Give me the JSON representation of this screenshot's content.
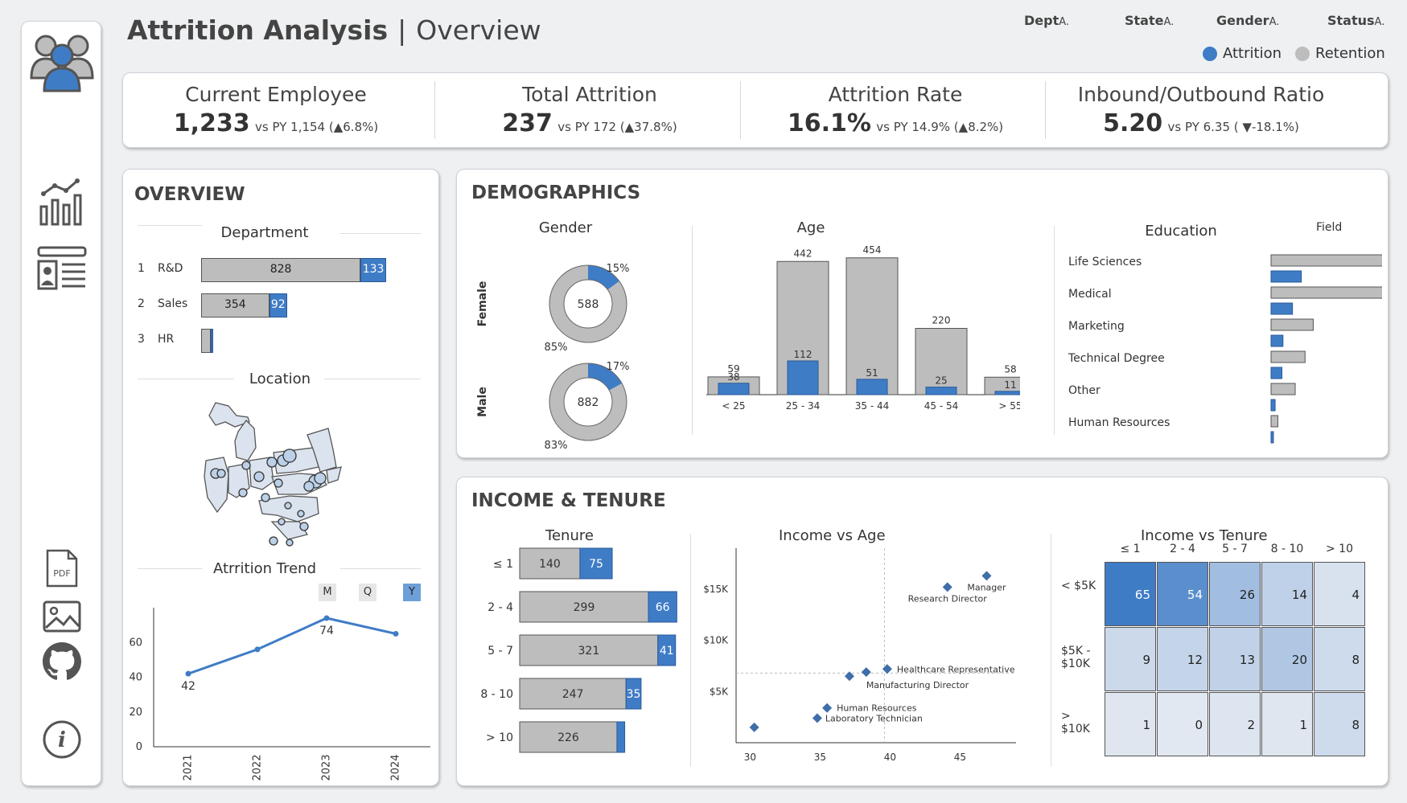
{
  "header": {
    "title": "Attrition Analysis",
    "separator": "|",
    "subtitle": "Overview",
    "filters": [
      {
        "label": "Dept",
        "suffix": "A."
      },
      {
        "label": "State",
        "suffix": "A."
      },
      {
        "label": "Gender",
        "suffix": "A."
      },
      {
        "label": "Status",
        "suffix": "A."
      }
    ],
    "legend": [
      {
        "label": "Attrition",
        "color": "#3f7cc6"
      },
      {
        "label": "Retention",
        "color": "#bdbdbd"
      }
    ]
  },
  "sidebar": {
    "icons": [
      "users-icon",
      "bar-chart-icon",
      "profile-card-icon",
      "pdf-icon",
      "image-icon",
      "github-icon",
      "info-icon"
    ],
    "pdf_label": "PDF",
    "info_label": "i"
  },
  "kpis": [
    {
      "label": "Current Employee",
      "value": "1,233",
      "vs": "vs PY 1,154 (▲6.8%)"
    },
    {
      "label": "Total Attrition",
      "value": "237",
      "vs": "vs PY 172 (▲37.8%)"
    },
    {
      "label": "Attrition Rate",
      "value": "16.1%",
      "vs": "vs PY 14.9% (▲8.2%)"
    },
    {
      "label": "Inbound/Outbound Ratio",
      "value": "5.20",
      "vs": "vs PY 6.35 ( ▼-18.1%)"
    }
  ],
  "overview": {
    "title": "OVERVIEW",
    "department": {
      "title": "Department",
      "rows": [
        {
          "rank": "1",
          "name": "R&D",
          "retention": 828,
          "attrition": 133,
          "retention_label": "828",
          "attrition_label": "133"
        },
        {
          "rank": "2",
          "name": "Sales",
          "retention": 354,
          "attrition": 92,
          "retention_label": "354",
          "attrition_label": "92"
        },
        {
          "rank": "3",
          "name": "HR",
          "retention": 51,
          "attrition": 12,
          "retention_label": "",
          "attrition_label": ""
        }
      ]
    },
    "location": {
      "title": "Location"
    },
    "trend": {
      "title": "Atrrition Trend",
      "buttons": [
        "M",
        "Q",
        "Y"
      ],
      "active_button": "Y",
      "chart_data": {
        "type": "line",
        "x": [
          "2021",
          "2022",
          "2023",
          "2024"
        ],
        "values": [
          42,
          56,
          74,
          65
        ],
        "data_labels": [
          "42",
          "",
          "74",
          ""
        ],
        "yticks": [
          "0",
          "20",
          "40",
          "60"
        ],
        "ylim": [
          0,
          80
        ],
        "color": "#3f7cc6"
      }
    }
  },
  "demographics": {
    "title": "DEMOGRAPHICS",
    "gender": {
      "title": "Gender",
      "items": [
        {
          "label": "Female",
          "total": "588",
          "attrition_pct": 15,
          "attrition_label": "15%",
          "retention_label": "85%"
        },
        {
          "label": "Male",
          "total": "882",
          "attrition_pct": 17,
          "attrition_label": "17%",
          "retention_label": "83%"
        }
      ]
    },
    "age": {
      "title": "Age",
      "chart_data": {
        "type": "bar",
        "categories": [
          "< 25",
          "25 - 34",
          "35 - 44",
          "45 - 54",
          "> 55"
        ],
        "series": [
          {
            "name": "Retention",
            "values": [
              59,
              442,
              454,
              220,
              58
            ]
          },
          {
            "name": "Attrition",
            "values": [
              38,
              112,
              51,
              25,
              11
            ]
          }
        ],
        "ylim": [
          0,
          480
        ]
      }
    },
    "education": {
      "title": "Education",
      "field_label": "Field",
      "chart_data": {
        "type": "bar",
        "categories": [
          "Life Sciences",
          "Medical",
          "Marketing",
          "Technical Degree",
          "Other",
          "Human Resources"
        ],
        "series": [
          {
            "name": "Retention",
            "values": [
              517,
              401,
              124,
              100,
              71,
              20
            ]
          },
          {
            "name": "Attrition",
            "values": [
              89,
              63,
              35,
              32,
              12,
              7
            ]
          }
        ],
        "xlim": [
          0,
          520
        ]
      }
    }
  },
  "income_tenure": {
    "title": "INCOME & TENURE",
    "tenure": {
      "title": "Tenure",
      "chart_data": {
        "type": "bar",
        "categories": [
          "≤ 1",
          "2 - 4",
          "5 - 7",
          "8 - 10",
          "> 10"
        ],
        "series": [
          {
            "name": "Retention",
            "values": [
              140,
              299,
              321,
              247,
              226
            ]
          },
          {
            "name": "Attrition",
            "values": [
              75,
              66,
              41,
              35,
              18
            ]
          }
        ],
        "labels_retention": [
          "140",
          "299",
          "321",
          "247",
          "226"
        ],
        "labels_attrition": [
          "75",
          "66",
          "41",
          "35",
          ""
        ],
        "xlim": [
          0,
          370
        ]
      }
    },
    "income_age": {
      "title": "Income vs Age",
      "chart_data": {
        "type": "scatter",
        "xticks": [
          "30",
          "35",
          "40",
          "45"
        ],
        "yticks": [
          "$5K",
          "$10K",
          "$15K"
        ],
        "xlim": [
          29,
          49
        ],
        "ylim": [
          0,
          19000
        ],
        "points": [
          {
            "x": 46.9,
            "y": 16300,
            "label": "Manager"
          },
          {
            "x": 44.1,
            "y": 15200,
            "label": "Research Director"
          },
          {
            "x": 39.8,
            "y": 7200,
            "label": "Healthcare Representative"
          },
          {
            "x": 38.3,
            "y": 6900,
            "label": "Manufacturing Director"
          },
          {
            "x": 37.1,
            "y": 6500,
            "label": ""
          },
          {
            "x": 35.5,
            "y": 3400,
            "label": "Human Resources"
          },
          {
            "x": 34.8,
            "y": 2400,
            "label": "Laboratory Technician"
          },
          {
            "x": 30.3,
            "y": 1500,
            "label": ""
          }
        ]
      }
    },
    "income_tenure_heatmap": {
      "title": "Income vs Tenure",
      "chart_data": {
        "type": "heatmap",
        "columns": [
          "≤ 1",
          "2 - 4",
          "5 - 7",
          "8 - 10",
          "> 10"
        ],
        "rows": [
          "< $5K",
          "$5K - $10K",
          "> $10K"
        ],
        "values": [
          [
            65,
            54,
            26,
            14,
            4
          ],
          [
            9,
            12,
            13,
            20,
            8
          ],
          [
            1,
            0,
            2,
            1,
            8
          ]
        ]
      }
    }
  }
}
